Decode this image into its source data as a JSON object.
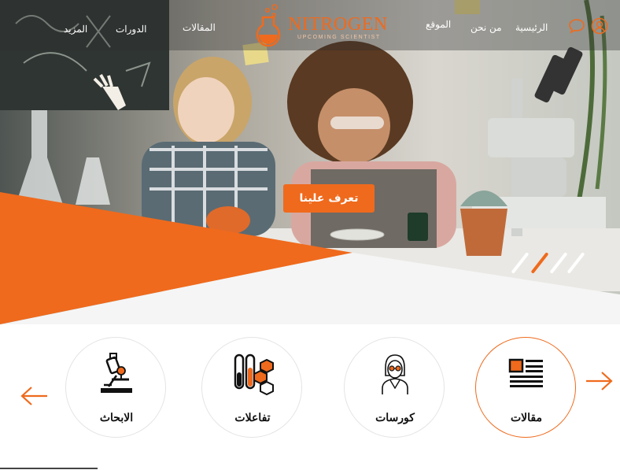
{
  "nav": {
    "home": "الرئيسية",
    "about": "من نحن",
    "site": "الموقع",
    "articles": "المقالات",
    "courses": "الدورات",
    "more": "المزيد"
  },
  "logo": {
    "word": "NITROGEN",
    "tagline": "UPCOMING SCIENTIST"
  },
  "hero": {
    "cta_label": "تعرف علينا",
    "slides_total": 4,
    "active_slide": 2
  },
  "categories": [
    {
      "label": "مقالات",
      "icon": "newspaper-icon",
      "active": true
    },
    {
      "label": "كورسات",
      "icon": "scientist-avatar-icon",
      "active": false
    },
    {
      "label": "تفاعلات",
      "icon": "test-tubes-molecule-icon",
      "active": false
    },
    {
      "label": "الابحاث",
      "icon": "microscope-icon",
      "active": false
    }
  ],
  "colors": {
    "accent": "#ef6a1d",
    "text": "#111111",
    "nav_text": "#ffffff"
  }
}
